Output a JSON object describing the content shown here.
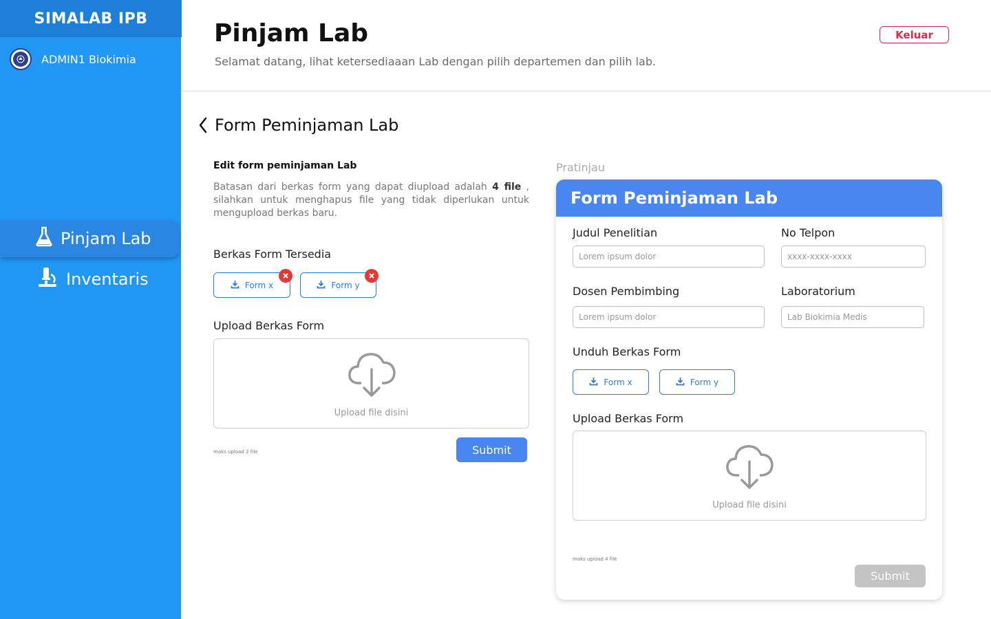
{
  "sidebar": {
    "brand": "SIMALAB IPB",
    "user": "ADMIN1 Biokimia",
    "items": [
      {
        "label": "Pinjam Lab",
        "icon": "flask-icon"
      },
      {
        "label": "Inventaris",
        "icon": "microscope-icon"
      }
    ]
  },
  "header": {
    "title": "Pinjam Lab",
    "subtitle": "Selamat datang, lihat ketersediaaan Lab dengan pilih departemen dan pilih lab.",
    "logout_label": "Keluar"
  },
  "section": {
    "title": "Form Peminjaman Lab"
  },
  "editor": {
    "title": "Edit form peminjaman Lab",
    "desc_before": "Batasan dari berkas form yang dapat diupload adalah ",
    "desc_bold": "4 file",
    "desc_after": " , silahkan untuk menghapus file yang tidak diperlukan untuk mengupload berkas baru.",
    "available_title": "Berkas Form Tersedia",
    "files": [
      "Form x",
      "Form y"
    ],
    "upload_title": "Upload Berkas Form",
    "upload_text": "Upload file disini",
    "max_note": "maks upload 2 file",
    "submit_label": "Submit"
  },
  "preview": {
    "label": "Pratinjau",
    "header": "Form Peminjaman Lab",
    "fields": {
      "judul_label": "Judul Penelitian",
      "judul_placeholder": "Lorem ipsum dolor",
      "telpon_label": "No Telpon",
      "telpon_placeholder": "xxxx-xxxx-xxxx",
      "dosen_label": "Dosen Pembimbing",
      "dosen_placeholder": "Lorem ipsum dolor",
      "lab_label": "Laboratorium",
      "lab_placeholder": "Lab Biokimia Medis"
    },
    "download_title": "Unduh Berkas Form",
    "files": [
      "Form x",
      "Form y"
    ],
    "upload_title": "Upload Berkas Form",
    "upload_text": "Upload file disini",
    "max_note": "maks upload 4 file",
    "submit_label": "Submit"
  },
  "colors": {
    "sidebar": "#2196f3",
    "brand_bar": "#1e7fd9",
    "primary": "#4a86f0",
    "logout": "#e0294a",
    "delete": "#e53935",
    "disabled": "#c4c4c4"
  }
}
